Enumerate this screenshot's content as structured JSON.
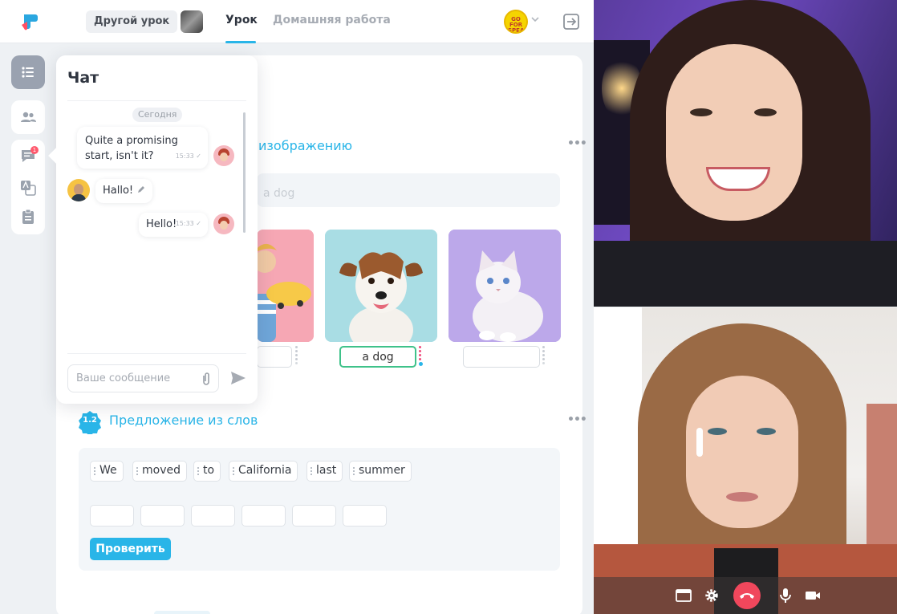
{
  "topbar": {
    "other_lesson": "Другой урок",
    "tab_lesson": "Урок",
    "tab_homework": "Домашняя работа",
    "avatar_text": "GO FOR SPEAK"
  },
  "rail": {
    "chat_badge": "1"
  },
  "section1": {
    "title": "изображению",
    "answer_hint": "a dog",
    "answers": [
      "",
      "a dog",
      ""
    ]
  },
  "section2": {
    "number": "1.2",
    "title": "Предложение из слов",
    "words": [
      "We",
      "moved",
      "to",
      "California",
      "last",
      "summer"
    ],
    "check_button": "Проверить"
  },
  "chat": {
    "title": "Чат",
    "date_label": "Сегодня",
    "messages": [
      {
        "text": "Quite a promising start, isn't it?",
        "time": "15:33"
      },
      {
        "text": "Hallo!"
      },
      {
        "text": "Hello!",
        "time": "15:33"
      }
    ],
    "input_placeholder": "Ваше сообщение"
  },
  "colors": {
    "accent": "#29b5e8",
    "correct": "#3fc28a",
    "hangup": "#f0475c"
  },
  "icons": [
    "logo-icon",
    "list-icon",
    "people-icon",
    "chat-icon",
    "translate-icon",
    "clipboard-icon",
    "exit-icon",
    "chevron-down-icon",
    "pencil-icon",
    "paperclip-icon",
    "send-icon",
    "screen-share-icon",
    "settings-icon",
    "hangup-icon",
    "microphone-icon",
    "camera-icon"
  ]
}
